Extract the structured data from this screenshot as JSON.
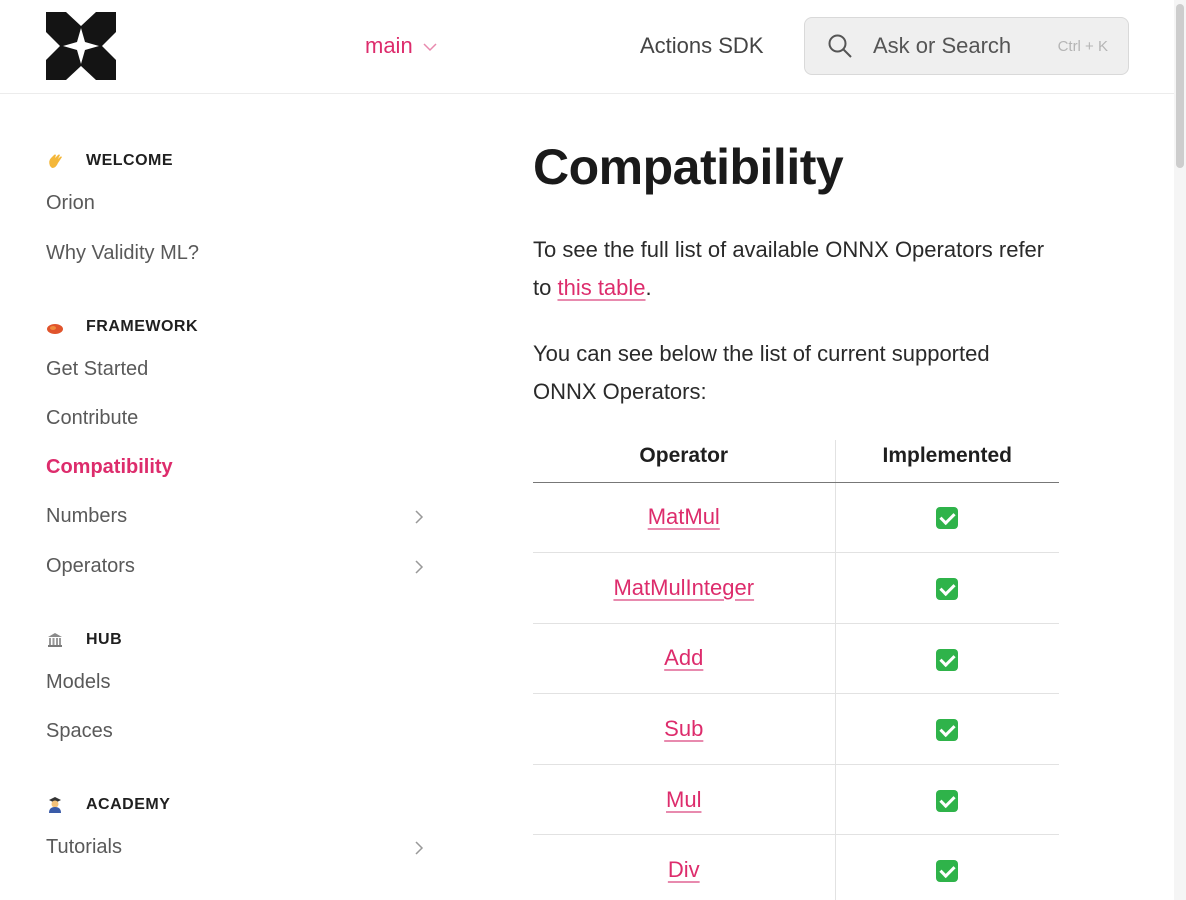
{
  "header": {
    "version_label": "main",
    "sdk_link": "Actions SDK",
    "search_placeholder": "Ask or Search",
    "search_shortcut": "Ctrl + K"
  },
  "sidebar": {
    "sections": [
      {
        "title": "WELCOME",
        "icon": "waving-hand-icon",
        "items": [
          "Orion",
          "Why Validity ML?"
        ]
      },
      {
        "title": "FRAMEWORK",
        "icon": "fire-icon",
        "items": [
          "Get Started",
          "Contribute",
          "Compatibility",
          "Numbers",
          "Operators"
        ]
      },
      {
        "title": "HUB",
        "icon": "classical-building-icon",
        "items": [
          "Models",
          "Spaces"
        ]
      },
      {
        "title": "ACADEMY",
        "icon": "graduate-icon",
        "items": [
          "Tutorials"
        ]
      }
    ],
    "active_item": "Compatibility"
  },
  "main": {
    "title": "Compatibility",
    "intro_before_link": "To see the full list of available ONNX Operators refer to ",
    "intro_link": "this table",
    "intro_after_link": ".",
    "supported_text": "You can see below the list of current supported ONNX Operators:",
    "table": {
      "headers": [
        "Operator",
        "Implemented"
      ],
      "rows": [
        {
          "operator": "MatMul",
          "implemented": "✅"
        },
        {
          "operator": "MatMulInteger",
          "implemented": "✅"
        },
        {
          "operator": "Add",
          "implemented": "✅"
        },
        {
          "operator": "Sub",
          "implemented": "✅"
        },
        {
          "operator": "Mul",
          "implemented": "✅"
        },
        {
          "operator": "Div",
          "implemented": "✅"
        }
      ]
    }
  },
  "colors": {
    "accent": "#dd2c6c",
    "check_green": "#2fb34a"
  }
}
